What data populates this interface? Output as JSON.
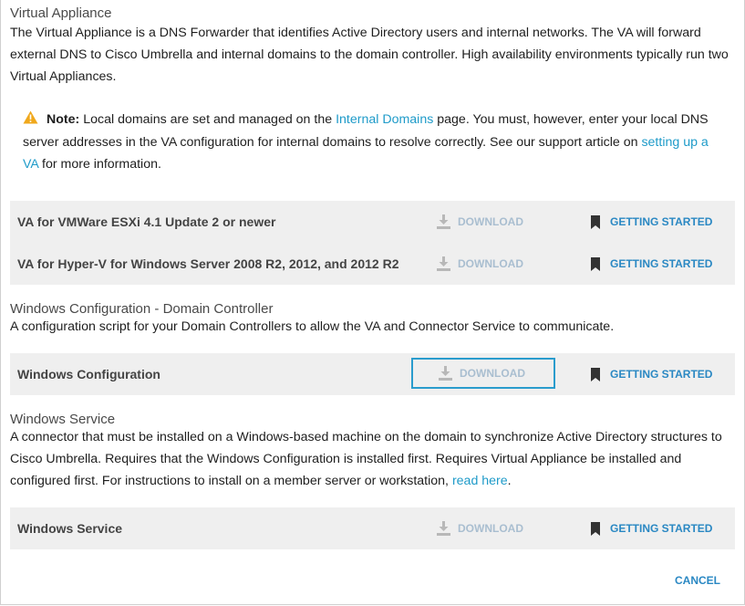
{
  "virtual_appliance": {
    "title": "Virtual Appliance",
    "description": "The Virtual Appliance is a DNS Forwarder that identifies Active Directory users and internal networks. The VA will forward external DNS to Cisco Umbrella and internal domains to the domain controller. High availability environments typically run two Virtual Appliances.",
    "note": {
      "label": "Note:",
      "text_1": " Local domains are set and managed on the ",
      "link_internal_domains": "Internal Domains",
      "text_2": " page. You must, however, enter your local DNS server addresses in the VA configuration for internal domains to resolve correctly. See our support article on ",
      "link_setting_up": "setting up a VA",
      "text_3": " for more information."
    },
    "rows": [
      {
        "label": "VA for VMWare ESXi 4.1 Update 2 or newer",
        "download": "DOWNLOAD",
        "getting_started": "GETTING STARTED"
      },
      {
        "label": "VA for Hyper-V for Windows Server 2008 R2, 2012, and 2012 R2",
        "download": "DOWNLOAD",
        "getting_started": "GETTING STARTED"
      }
    ]
  },
  "windows_configuration": {
    "title": "Windows Configuration - Domain Controller",
    "description": "A configuration script for your Domain Controllers to allow the VA and Connector Service to communicate.",
    "rows": [
      {
        "label": "Windows Configuration",
        "download": "DOWNLOAD",
        "getting_started": "GETTING STARTED"
      }
    ]
  },
  "windows_service": {
    "title": "Windows Service",
    "description": "A connector that must be installed on a Windows-based machine on the domain to synchronize Active Directory structures to Cisco Umbrella. Requires that the Windows Configuration is installed first. Requires Virtual Appliance be installed and configured first. For instructions to install on a member server or workstation, ",
    "link_read_here": "read here",
    "description_end": ".",
    "rows": [
      {
        "label": "Windows Service",
        "download": "DOWNLOAD",
        "getting_started": "GETTING STARTED"
      }
    ]
  },
  "footer": {
    "cancel_label": "CANCEL"
  },
  "icons": {
    "warning": "warning-triangle-icon",
    "download": "download-arrow-icon",
    "bookmark": "bookmark-icon"
  },
  "colors": {
    "link": "#1f9bc9",
    "action": "#2a88c3",
    "download_disabled": "#a9bed0",
    "focus_border": "#2a9ccd",
    "panel_bg": "#efefef",
    "warning": "#f0a81c"
  }
}
